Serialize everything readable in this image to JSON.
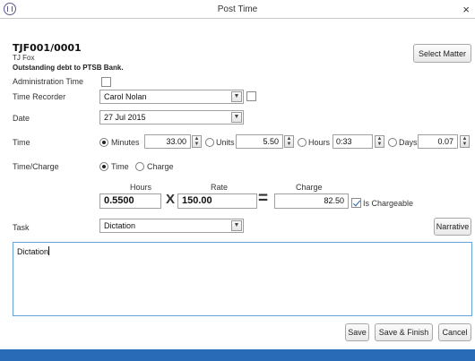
{
  "window": {
    "title": "Post Time",
    "close_glyph": "×",
    "app_icon": "app-logo-icon"
  },
  "matter": {
    "code": "TJF001/0001",
    "client": "TJ Fox",
    "description": "Outstanding debt to PTSB Bank.",
    "select_button": "Select Matter"
  },
  "form": {
    "admin_time": {
      "label": "Administration Time",
      "checked": false
    },
    "time_recorder": {
      "label": "Time Recorder",
      "value": "Carol Nolan",
      "checked": false
    },
    "date": {
      "label": "Date",
      "value": "27 Jul 2015"
    },
    "time": {
      "label": "Time",
      "options": [
        {
          "label": "Minutes",
          "value": "33.00",
          "selected": true
        },
        {
          "label": "Units",
          "value": "5.50",
          "selected": false
        },
        {
          "label": "Hours",
          "value": "0:33",
          "selected": false
        },
        {
          "label": "Days",
          "value": "0.07",
          "selected": false
        }
      ]
    },
    "time_charge": {
      "label": "Time/Charge",
      "opt_time": "Time",
      "opt_charge": "Charge",
      "selected": "Time"
    },
    "calc": {
      "hours_label": "Hours",
      "hours_value": "0.5500",
      "rate_label": "Rate",
      "rate_value": "150.00",
      "charge_label": "Charge",
      "charge_value": "82.50",
      "times_op": "X",
      "equals_op": "=",
      "chargeable_label": "Is Chargeable",
      "chargeable": true
    },
    "task": {
      "label": "Task",
      "value": "Dictation",
      "narrative_button": "Narrative"
    },
    "notes": "Dictation"
  },
  "footer": {
    "save": "Save",
    "save_finish": "Save & Finish",
    "cancel": "Cancel"
  },
  "colors": {
    "accent_bar": "#2a6bb8",
    "focus_border": "#6aa0d8"
  }
}
